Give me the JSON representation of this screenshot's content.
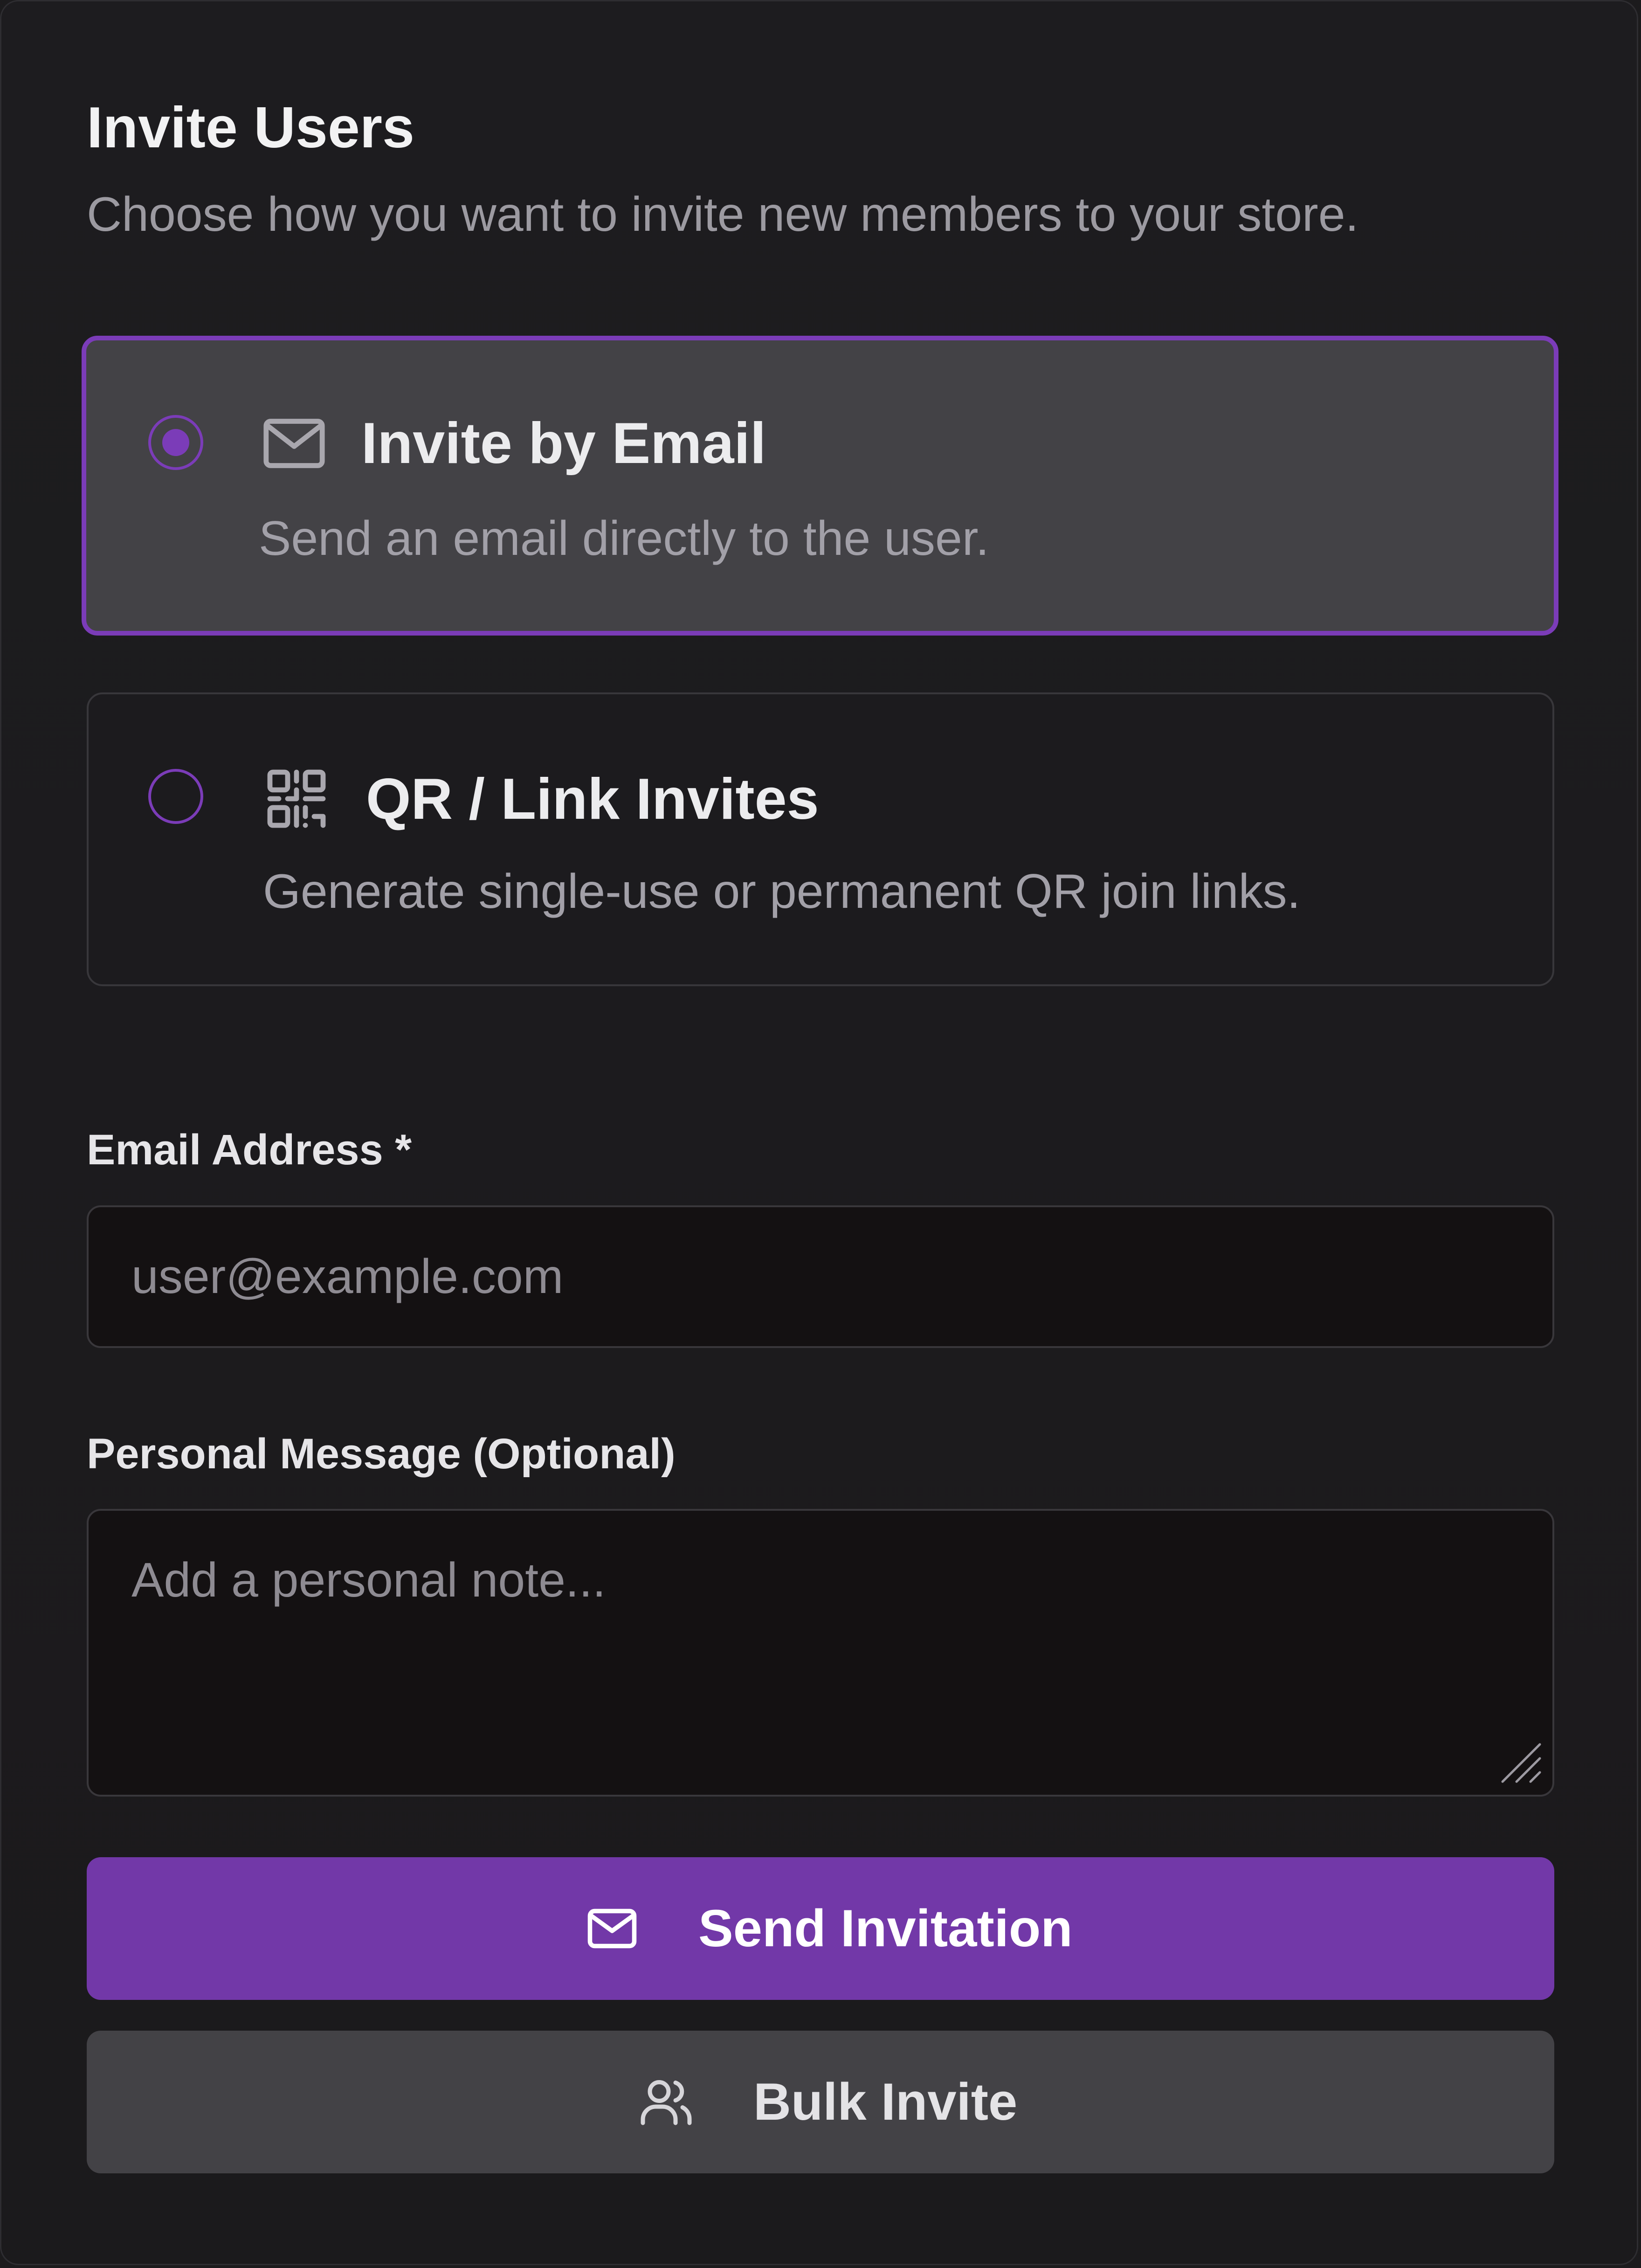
{
  "dialog": {
    "title": "Invite Users",
    "subtitle": "Choose how you want to invite new members to your store."
  },
  "options": [
    {
      "title": "Invite by Email",
      "description": "Send an email directly to the user.",
      "icon": "mail-icon",
      "selected": true
    },
    {
      "title": "QR / Link Invites",
      "description": "Generate single-use or permanent QR join links.",
      "icon": "qr-code-icon",
      "selected": false
    }
  ],
  "form": {
    "email_label": "Email Address *",
    "email_value": "",
    "email_placeholder": "user@example.com",
    "message_label": "Personal Message (Optional)",
    "message_value": "",
    "message_placeholder": "Add a personal note..."
  },
  "actions": {
    "send_label": "Send Invitation",
    "send_icon": "mail-icon",
    "bulk_label": "Bulk Invite",
    "bulk_icon": "users-icon"
  },
  "colors": {
    "accent": "#7b3cb8",
    "primary_button": "#7238a8",
    "selected_card": "#434246",
    "background": "#1c1b1d"
  }
}
